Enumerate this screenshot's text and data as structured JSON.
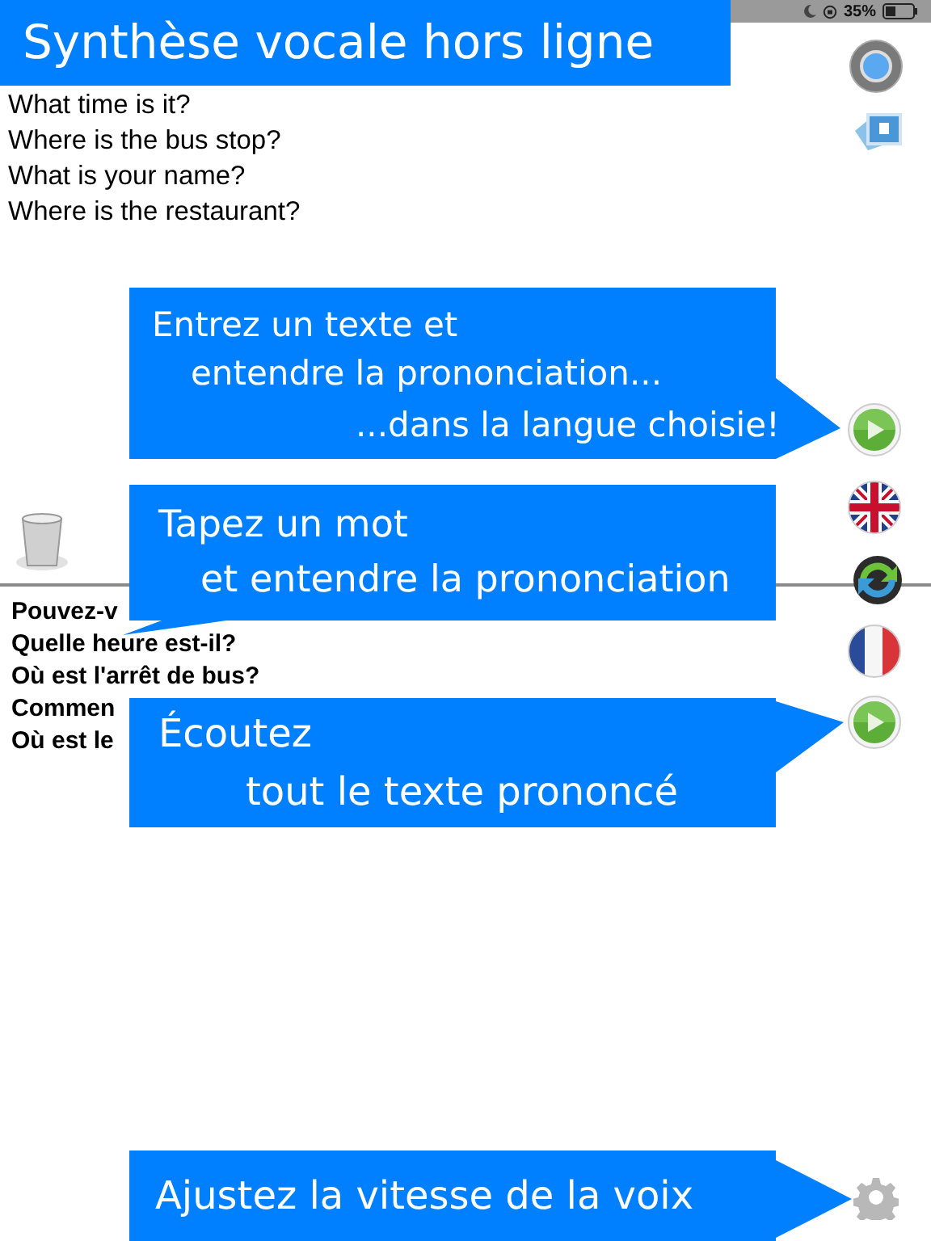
{
  "status_bar": {
    "battery": "35%"
  },
  "banner": {
    "title": "Synthèse vocale hors ligne"
  },
  "source_text": {
    "lines": [
      "What time is it?",
      "Where is the bus stop?",
      "What is your name?",
      "Where is the restaurant?"
    ]
  },
  "translation_text": {
    "lines": [
      "Pouvez-v",
      "Quelle heure est-il?",
      "Où est l'arrêt de bus?",
      "Commen",
      "Où est le"
    ]
  },
  "callouts": [
    {
      "lines": [
        "Entrez un texte et",
        "entendre la prononciation...",
        "...dans la langue choisie!"
      ]
    },
    {
      "lines": [
        "Tapez un mot",
        "et entendre la prononciation"
      ]
    },
    {
      "lines": [
        "Écoutez",
        "tout le texte prononcé"
      ]
    },
    {
      "lines": [
        "Ajustez la vitesse de la voix"
      ]
    }
  ]
}
